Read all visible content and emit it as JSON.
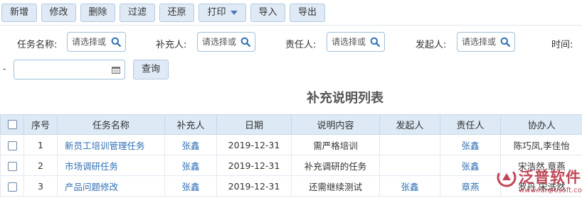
{
  "toolbar": {
    "buttons": [
      "新增",
      "修改",
      "删除",
      "过滤",
      "还原",
      "打印",
      "导入",
      "导出"
    ]
  },
  "filters": {
    "task_name_label": "任务名称:",
    "supplementer_label": "补充人:",
    "responsible_label": "责任人:",
    "initiator_label": "发起人:",
    "time_label": "时间:",
    "placeholder": "请选择或",
    "date_separator": "-",
    "query_label": "查询"
  },
  "report": {
    "title": "补充说明列表"
  },
  "table": {
    "headers": [
      "序号",
      "任务名称",
      "补充人",
      "日期",
      "说明内容",
      "发起人",
      "责任人",
      "协办人"
    ],
    "rows": [
      {
        "no": "1",
        "task": "新员工培训管理任务",
        "supplementer": "张鑫",
        "date": "2019-12-31",
        "content": "需严格培训",
        "initiator": "",
        "responsible": "张鑫",
        "assistants": "陈巧凤,李佳怡"
      },
      {
        "no": "2",
        "task": "市场调研任务",
        "supplementer": "张鑫",
        "date": "2019-12-31",
        "content": "补充调研的任务",
        "initiator": "",
        "responsible": "张鑫",
        "assistants": "宋浩然,章燕"
      },
      {
        "no": "3",
        "task": "产品问题修改",
        "supplementer": "张鑫",
        "date": "2019-12-31",
        "content": "还需继续测试",
        "initiator": "张鑫",
        "responsible": "章燕",
        "assistants": "罗丹,宋浩然"
      }
    ]
  },
  "watermark": {
    "name": "泛普软件",
    "url": "www.fanpusoft.com"
  },
  "icons": {
    "search": "search-icon",
    "calendar": "calendar-icon",
    "dropdown": "caret-down-icon",
    "checkbox": "checkbox-icon",
    "logo": "brand-logo-icon"
  },
  "colors": {
    "accent": "#2f6fb5",
    "toolbar_button": "#dfeaf6",
    "header_bg": "#dde9f5",
    "brand": "#b5283a"
  }
}
